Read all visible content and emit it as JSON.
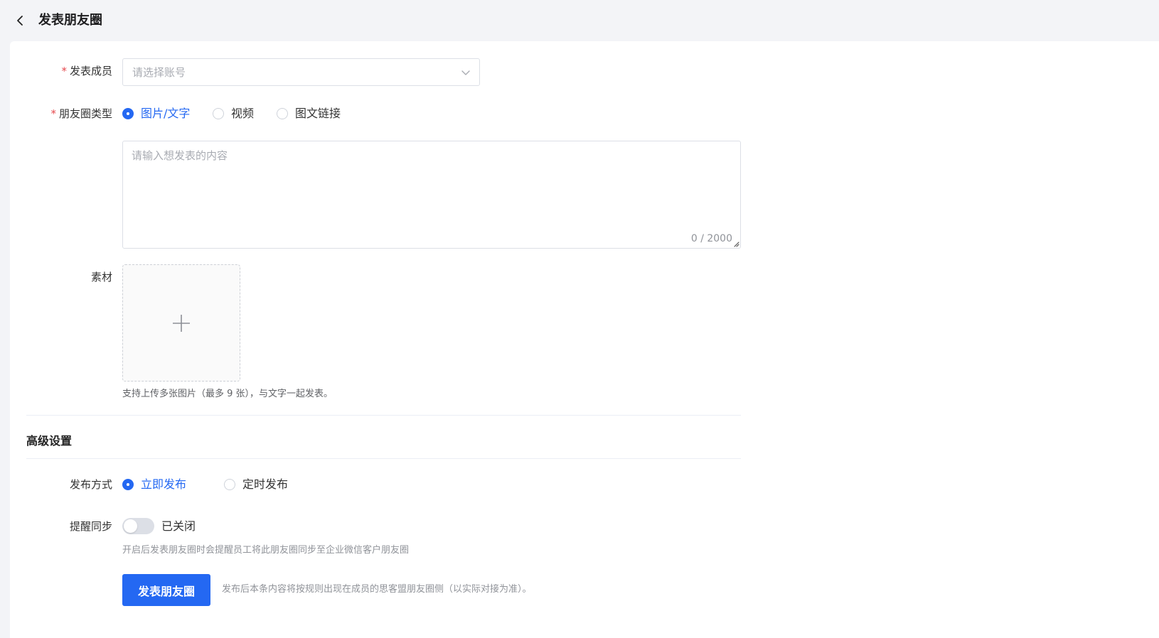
{
  "header": {
    "title": "发表朋友圈"
  },
  "form": {
    "member": {
      "label": "发表成员",
      "placeholder": "请选择账号"
    },
    "type": {
      "label": "朋友圈类型",
      "options": [
        "图片/文字",
        "视频",
        "图文链接"
      ],
      "selected": "图片/文字"
    },
    "content": {
      "placeholder": "请输入想发表的内容",
      "counter": "0 / 2000"
    },
    "material": {
      "label": "素材",
      "hint": "支持上传多张图片（最多 9 张），与文字一起发表。"
    }
  },
  "advanced": {
    "title": "高级设置",
    "publish_mode": {
      "label": "发布方式",
      "options": [
        "立即发布",
        "定时发布"
      ],
      "selected": "立即发布"
    },
    "remind_sync": {
      "label": "提醒同步",
      "state": "已关闭",
      "hint": "开启后发表朋友圈时会提醒员工将此朋友圈同步至企业微信客户朋友圈"
    }
  },
  "footer": {
    "submit_label": "发表朋友圈",
    "note": "发布后本条内容将按规则出现在成员的思客盟朋友圈侧（以实际对接为准）。"
  },
  "colors": {
    "primary": "#2468f2",
    "required": "#e5484d",
    "background": "#f3f4f7"
  }
}
